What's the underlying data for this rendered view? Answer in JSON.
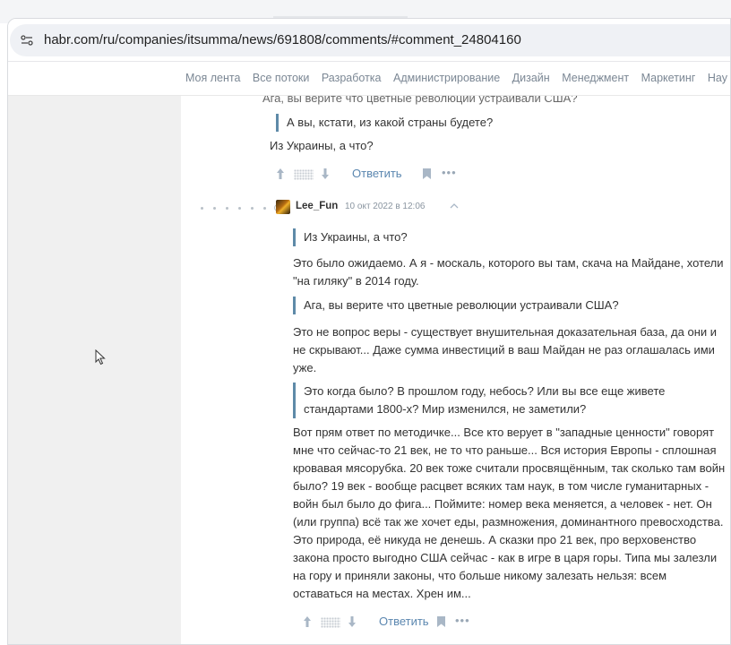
{
  "browser": {
    "url": "habr.com/ru/companies/itsumma/news/691808/comments/#comment_24804160"
  },
  "nav": {
    "items": [
      "Моя лента",
      "Все потоки",
      "Разработка",
      "Администрирование",
      "Дизайн",
      "Менеджмент",
      "Маркетинг",
      "Нау"
    ]
  },
  "top_comment": {
    "cut_text": "Ага, вы верите что цветные революции устраивали США?",
    "quote": "А вы, кстати, из какой страны будете?",
    "text": "Из Украины, а что?",
    "reply_label": "Ответить"
  },
  "comment": {
    "author": "Lee_Fun",
    "timestamp": "10 окт 2022 в 12:06",
    "quote1": "Из Украины, а что?",
    "para1": "Это было ожидаемо. А я - москаль, которого вы там, скача на Майдане, хотели \"на гиляку\" в 2014 году.",
    "quote2": "Ага, вы верите что цветные революции устраивали США?",
    "para2": "Это не вопрос веры - существует внушительная доказательная база, да они и не скрывают... Даже сумма инвестиций в ваш Майдан не раз оглашалась ими уже.",
    "quote3": "Это когда было? В прошлом году, небось? Или вы все еще живете стандартами 1800-х? Мир изменился, не заметили?",
    "para3": "Вот прям ответ по методичке... Все кто верует в \"западные ценности\" говорят мне что сейчас-то 21 век, не то что раньше... Вся история Европы - сплошная кровавая мясорубка. 20 век тоже считали просвящённым, так сколько там войн было? 19 век - вообще расцвет всяких там наук, в том числе гуманитарных - войн был было до фига... Поймите: номер века меняется, а человек - нет. Он (или группа) всё так же хочет еды, размножения, доминантного превосходства. Это природа, её никуда не денешь. А сказки про 21 век, про верховенство закона просто выгодно США сейчас - как в игре в царя горы. Типа мы залезли на гору и приняли законы, что больше никому залезать нельзя: всем оставаться на местах. Хрен им...",
    "reply_label": "Ответить"
  },
  "colors": {
    "accent": "#5b87b0",
    "quote_bar": "#5e8aa8",
    "gutter": "#f0f0f0"
  },
  "icons": [
    "site-settings-icon",
    "arrow-up-icon",
    "arrow-down-icon",
    "bookmark-icon",
    "more-icon",
    "chevron-up-icon",
    "mouse-cursor-icon"
  ]
}
